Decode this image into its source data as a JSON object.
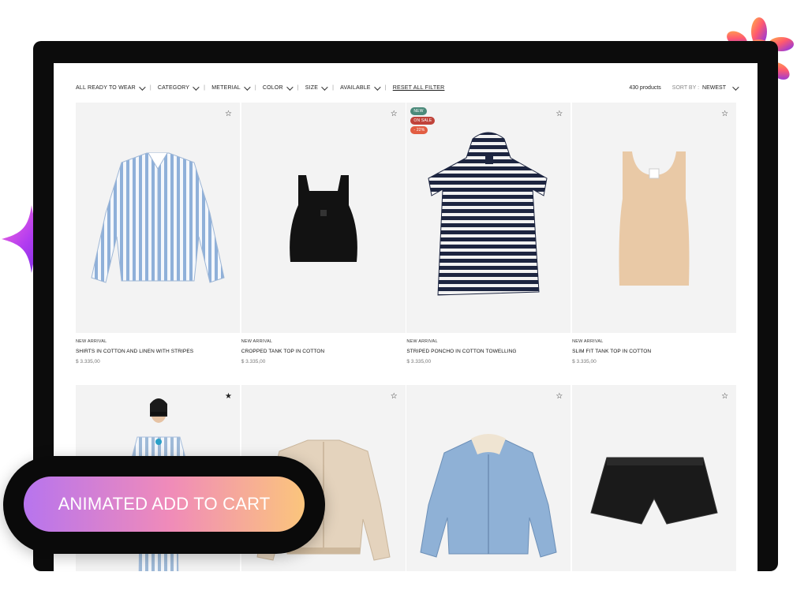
{
  "toolbar": {
    "filters": [
      {
        "label": "ALL READY TO WEAR"
      },
      {
        "label": "CATEGORY"
      },
      {
        "label": "METERIAL"
      },
      {
        "label": "COLOR"
      },
      {
        "label": "SIZE"
      },
      {
        "label": "AVAILABLE"
      }
    ],
    "reset_label": "RESET ALL FILTER",
    "count": "430 products",
    "sort_label": "SORT BY :",
    "sort_value": "NEWEST"
  },
  "products": [
    {
      "tag": "NEW ARRIVAL",
      "name": "SHIRTS IN COTTON AND LINEN WITH STRIPES",
      "price": "$ 3.335,00"
    },
    {
      "tag": "NEW ARRIVAL",
      "name": "CROPPED TANK TOP IN COTTON",
      "price": "$ 3.335,00"
    },
    {
      "tag": "NEW ARRIVAL",
      "name": "STRIPED PONCHO IN COTTON TOWELLING",
      "price": "$ 3.335,00",
      "badges": [
        "NEW",
        "ON SALE",
        "- 22%"
      ]
    },
    {
      "tag": "NEW ARRIVAL",
      "name": "SLIM FIT TANK TOP IN COTTON",
      "price": "$ 3.335,00"
    }
  ],
  "cta": {
    "label": "ANIMATED ADD TO CART"
  },
  "colors": {
    "cta_gradient": [
      "#b774ee",
      "#f08bb9",
      "#fbc57c"
    ],
    "badge_new": "#4b8a7a",
    "badge_sale": "#c0433a",
    "badge_discount": "#e25d42"
  }
}
